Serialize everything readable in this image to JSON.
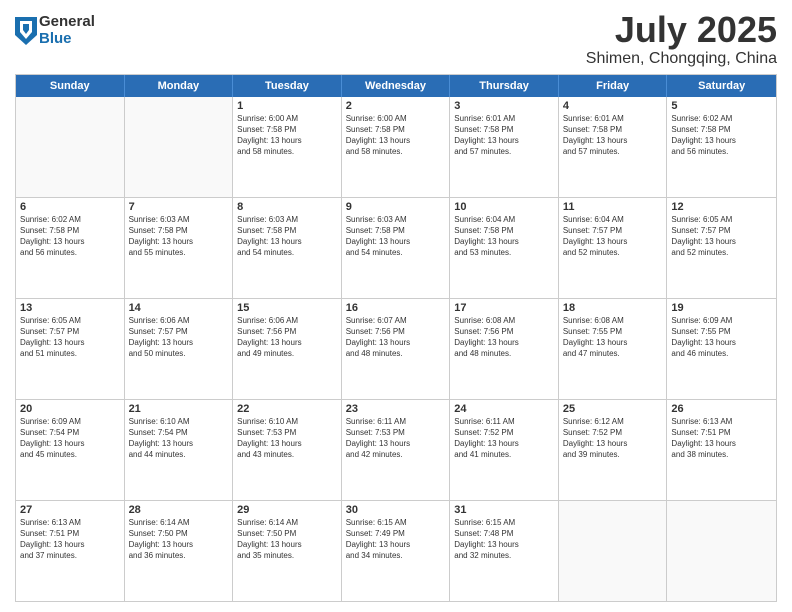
{
  "logo": {
    "general": "General",
    "blue": "Blue"
  },
  "title": "July 2025",
  "location": "Shimen, Chongqing, China",
  "headers": [
    "Sunday",
    "Monday",
    "Tuesday",
    "Wednesday",
    "Thursday",
    "Friday",
    "Saturday"
  ],
  "rows": [
    [
      {
        "day": "",
        "info": ""
      },
      {
        "day": "",
        "info": ""
      },
      {
        "day": "1",
        "info": "Sunrise: 6:00 AM\nSunset: 7:58 PM\nDaylight: 13 hours\nand 58 minutes."
      },
      {
        "day": "2",
        "info": "Sunrise: 6:00 AM\nSunset: 7:58 PM\nDaylight: 13 hours\nand 58 minutes."
      },
      {
        "day": "3",
        "info": "Sunrise: 6:01 AM\nSunset: 7:58 PM\nDaylight: 13 hours\nand 57 minutes."
      },
      {
        "day": "4",
        "info": "Sunrise: 6:01 AM\nSunset: 7:58 PM\nDaylight: 13 hours\nand 57 minutes."
      },
      {
        "day": "5",
        "info": "Sunrise: 6:02 AM\nSunset: 7:58 PM\nDaylight: 13 hours\nand 56 minutes."
      }
    ],
    [
      {
        "day": "6",
        "info": "Sunrise: 6:02 AM\nSunset: 7:58 PM\nDaylight: 13 hours\nand 56 minutes."
      },
      {
        "day": "7",
        "info": "Sunrise: 6:03 AM\nSunset: 7:58 PM\nDaylight: 13 hours\nand 55 minutes."
      },
      {
        "day": "8",
        "info": "Sunrise: 6:03 AM\nSunset: 7:58 PM\nDaylight: 13 hours\nand 54 minutes."
      },
      {
        "day": "9",
        "info": "Sunrise: 6:03 AM\nSunset: 7:58 PM\nDaylight: 13 hours\nand 54 minutes."
      },
      {
        "day": "10",
        "info": "Sunrise: 6:04 AM\nSunset: 7:58 PM\nDaylight: 13 hours\nand 53 minutes."
      },
      {
        "day": "11",
        "info": "Sunrise: 6:04 AM\nSunset: 7:57 PM\nDaylight: 13 hours\nand 52 minutes."
      },
      {
        "day": "12",
        "info": "Sunrise: 6:05 AM\nSunset: 7:57 PM\nDaylight: 13 hours\nand 52 minutes."
      }
    ],
    [
      {
        "day": "13",
        "info": "Sunrise: 6:05 AM\nSunset: 7:57 PM\nDaylight: 13 hours\nand 51 minutes."
      },
      {
        "day": "14",
        "info": "Sunrise: 6:06 AM\nSunset: 7:57 PM\nDaylight: 13 hours\nand 50 minutes."
      },
      {
        "day": "15",
        "info": "Sunrise: 6:06 AM\nSunset: 7:56 PM\nDaylight: 13 hours\nand 49 minutes."
      },
      {
        "day": "16",
        "info": "Sunrise: 6:07 AM\nSunset: 7:56 PM\nDaylight: 13 hours\nand 48 minutes."
      },
      {
        "day": "17",
        "info": "Sunrise: 6:08 AM\nSunset: 7:56 PM\nDaylight: 13 hours\nand 48 minutes."
      },
      {
        "day": "18",
        "info": "Sunrise: 6:08 AM\nSunset: 7:55 PM\nDaylight: 13 hours\nand 47 minutes."
      },
      {
        "day": "19",
        "info": "Sunrise: 6:09 AM\nSunset: 7:55 PM\nDaylight: 13 hours\nand 46 minutes."
      }
    ],
    [
      {
        "day": "20",
        "info": "Sunrise: 6:09 AM\nSunset: 7:54 PM\nDaylight: 13 hours\nand 45 minutes."
      },
      {
        "day": "21",
        "info": "Sunrise: 6:10 AM\nSunset: 7:54 PM\nDaylight: 13 hours\nand 44 minutes."
      },
      {
        "day": "22",
        "info": "Sunrise: 6:10 AM\nSunset: 7:53 PM\nDaylight: 13 hours\nand 43 minutes."
      },
      {
        "day": "23",
        "info": "Sunrise: 6:11 AM\nSunset: 7:53 PM\nDaylight: 13 hours\nand 42 minutes."
      },
      {
        "day": "24",
        "info": "Sunrise: 6:11 AM\nSunset: 7:52 PM\nDaylight: 13 hours\nand 41 minutes."
      },
      {
        "day": "25",
        "info": "Sunrise: 6:12 AM\nSunset: 7:52 PM\nDaylight: 13 hours\nand 39 minutes."
      },
      {
        "day": "26",
        "info": "Sunrise: 6:13 AM\nSunset: 7:51 PM\nDaylight: 13 hours\nand 38 minutes."
      }
    ],
    [
      {
        "day": "27",
        "info": "Sunrise: 6:13 AM\nSunset: 7:51 PM\nDaylight: 13 hours\nand 37 minutes."
      },
      {
        "day": "28",
        "info": "Sunrise: 6:14 AM\nSunset: 7:50 PM\nDaylight: 13 hours\nand 36 minutes."
      },
      {
        "day": "29",
        "info": "Sunrise: 6:14 AM\nSunset: 7:50 PM\nDaylight: 13 hours\nand 35 minutes."
      },
      {
        "day": "30",
        "info": "Sunrise: 6:15 AM\nSunset: 7:49 PM\nDaylight: 13 hours\nand 34 minutes."
      },
      {
        "day": "31",
        "info": "Sunrise: 6:15 AM\nSunset: 7:48 PM\nDaylight: 13 hours\nand 32 minutes."
      },
      {
        "day": "",
        "info": ""
      },
      {
        "day": "",
        "info": ""
      }
    ]
  ]
}
